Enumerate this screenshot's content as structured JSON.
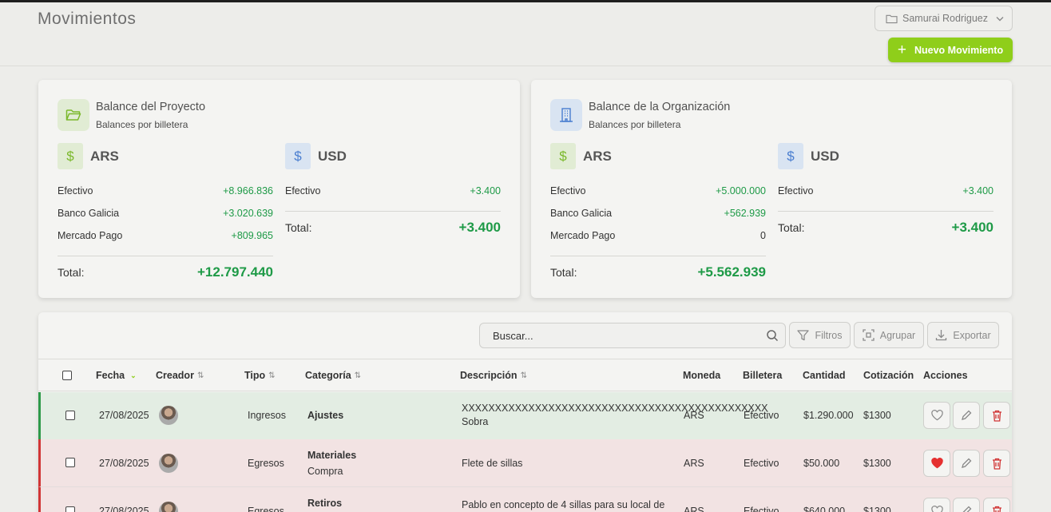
{
  "header": {
    "title": "Movimientos",
    "project_selector": "Samurai Rodriguez",
    "new_button": "Nuevo Movimiento"
  },
  "project_balance": {
    "title": "Balance del Proyecto",
    "subtitle": "Balances por billetera",
    "ars": {
      "code": "ARS",
      "rows": [
        {
          "label": "Efectivo",
          "value": "+8.966.836"
        },
        {
          "label": "Banco Galicia",
          "value": "+3.020.639"
        },
        {
          "label": "Mercado Pago",
          "value": "+809.965"
        }
      ],
      "total_label": "Total:",
      "total": "+12.797.440"
    },
    "usd": {
      "code": "USD",
      "rows": [
        {
          "label": "Efectivo",
          "value": "+3.400"
        }
      ],
      "total_label": "Total:",
      "total": "+3.400"
    }
  },
  "org_balance": {
    "title": "Balance de la Organización",
    "subtitle": "Balances por billetera",
    "ars": {
      "code": "ARS",
      "rows": [
        {
          "label": "Efectivo",
          "value": "+5.000.000"
        },
        {
          "label": "Banco Galicia",
          "value": "+562.939"
        },
        {
          "label": "Mercado Pago",
          "value": "0"
        }
      ],
      "total_label": "Total:",
      "total": "+5.562.939"
    },
    "usd": {
      "code": "USD",
      "rows": [
        {
          "label": "Efectivo",
          "value": "+3.400"
        }
      ],
      "total_label": "Total:",
      "total": "+3.400"
    }
  },
  "toolbar": {
    "search_placeholder": "Buscar...",
    "filters": "Filtros",
    "group": "Agrupar",
    "export": "Exportar"
  },
  "table": {
    "columns": {
      "fecha": "Fecha",
      "creador": "Creador",
      "tipo": "Tipo",
      "categoria": "Categoría",
      "descripcion": "Descripción",
      "moneda": "Moneda",
      "billetera": "Billetera",
      "cantidad": "Cantidad",
      "cotizacion": "Cotización",
      "acciones": "Acciones"
    },
    "rows": [
      {
        "fecha": "27/08/2025",
        "tipo": "Ingresos",
        "categoria": "Ajustes",
        "subcategoria": "",
        "descripcion": "XXXXXXXXXXXXXXXXXXXXXXXXXXXXXXXXXXXXXXXXXXXXXX",
        "descripcion2": "Sobra",
        "moneda": "ARS",
        "billetera": "Efectivo",
        "cantidad": "$1.290.000",
        "cotizacion": "$1300",
        "favorite": false
      },
      {
        "fecha": "27/08/2025",
        "tipo": "Egresos",
        "categoria": "Materiales",
        "subcategoria": "Compra",
        "descripcion": "Flete de sillas",
        "descripcion2": "",
        "moneda": "ARS",
        "billetera": "Efectivo",
        "cantidad": "$50.000",
        "cotizacion": "$1300",
        "favorite": true
      },
      {
        "fecha": "27/08/2025",
        "tipo": "Egresos",
        "categoria": "Retiros",
        "subcategoria": "",
        "descripcion": "Pablo en concepto de 4 sillas para su local de",
        "descripcion2": "",
        "moneda": "ARS",
        "billetera": "Efectivo",
        "cantidad": "$640.000",
        "cotizacion": "$1300",
        "favorite": false
      }
    ]
  },
  "colors": {
    "accent": "#8fce1a",
    "positive": "#1e9a47",
    "income_bar": "#2e9a4a",
    "expense_bar": "#d13535"
  }
}
